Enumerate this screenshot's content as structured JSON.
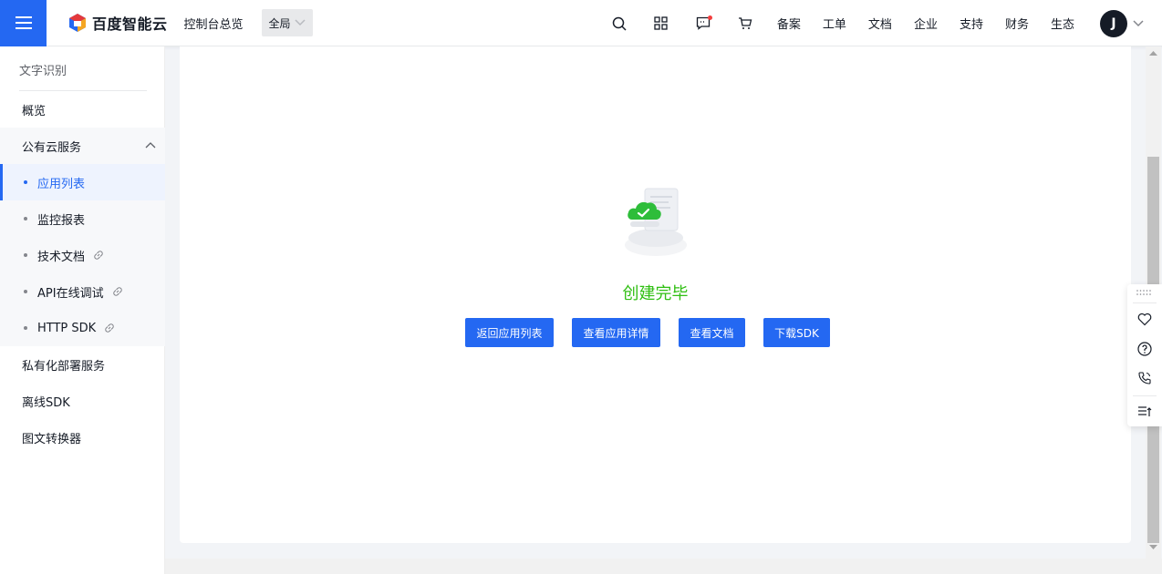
{
  "header": {
    "brand": "百度智能云",
    "console_link": "控制台总览",
    "region": "全局",
    "links": [
      "备案",
      "工单",
      "文档",
      "企业",
      "支持",
      "财务",
      "生态"
    ],
    "avatar_initial": "J",
    "icons": [
      "menu-icon",
      "search-icon",
      "apps-icon",
      "message-icon",
      "cart-icon",
      "chevron-down-icon"
    ]
  },
  "sidebar": {
    "title": "文字识别",
    "items": [
      {
        "label": "概览"
      },
      {
        "label": "公有云服务"
      },
      {
        "label": "应用列表"
      },
      {
        "label": "监控报表"
      },
      {
        "label": "技术文档"
      },
      {
        "label": "API在线调试"
      },
      {
        "label": "HTTP SDK"
      },
      {
        "label": "私有化部署服务"
      },
      {
        "label": "离线SDK"
      },
      {
        "label": "图文转换器"
      }
    ]
  },
  "main": {
    "status_text": "创建完毕",
    "buttons": [
      "返回应用列表",
      "查看应用详情",
      "查看文档",
      "下载SDK"
    ]
  },
  "float_toolbar": {
    "icons": [
      "drag-handle-icon",
      "heart-icon",
      "help-icon",
      "phone-icon",
      "list-sort-icon"
    ]
  },
  "colors": {
    "primary": "#2468f2",
    "success_text": "#30bf13",
    "header_bg": "#ffffff",
    "page_bg": "#f2f4f7"
  }
}
